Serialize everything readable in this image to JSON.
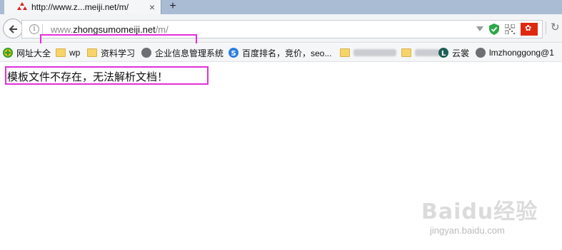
{
  "tab": {
    "title": "http://www.z...meiji.net/m/",
    "close_icon": "×",
    "new_tab_icon": "+"
  },
  "navbar": {
    "url_prefix": "www.",
    "url_host": "zhongsumomeiji.net",
    "url_path": "/m/",
    "info_icon": "i",
    "reload_icon": "↻"
  },
  "bookmarks": [
    {
      "label": "网址大全",
      "icon": "plus-circle-icon"
    },
    {
      "label": "wp",
      "icon": "folder-icon"
    },
    {
      "label": "资料学习",
      "icon": "folder-icon"
    },
    {
      "label": "企业信息管理系统",
      "icon": "globe-icon"
    },
    {
      "label": "百度排名，竞价，seo...",
      "icon": "s-logo-icon"
    },
    {
      "label": "",
      "icon": "folder-icon"
    },
    {
      "label": "",
      "icon": "folder-icon"
    },
    {
      "label": "云裳",
      "icon": "l-logo-icon"
    },
    {
      "label": "lmzhonggong@1",
      "icon": "globe-icon"
    }
  ],
  "page": {
    "message": "模板文件不存在，无法解析文档！"
  },
  "watermark": {
    "logo": "Baidu经验",
    "sub": "jingyan.baidu.com"
  },
  "colors": {
    "highlight": "#e330d8",
    "tabstrip": "#aabbd4"
  }
}
